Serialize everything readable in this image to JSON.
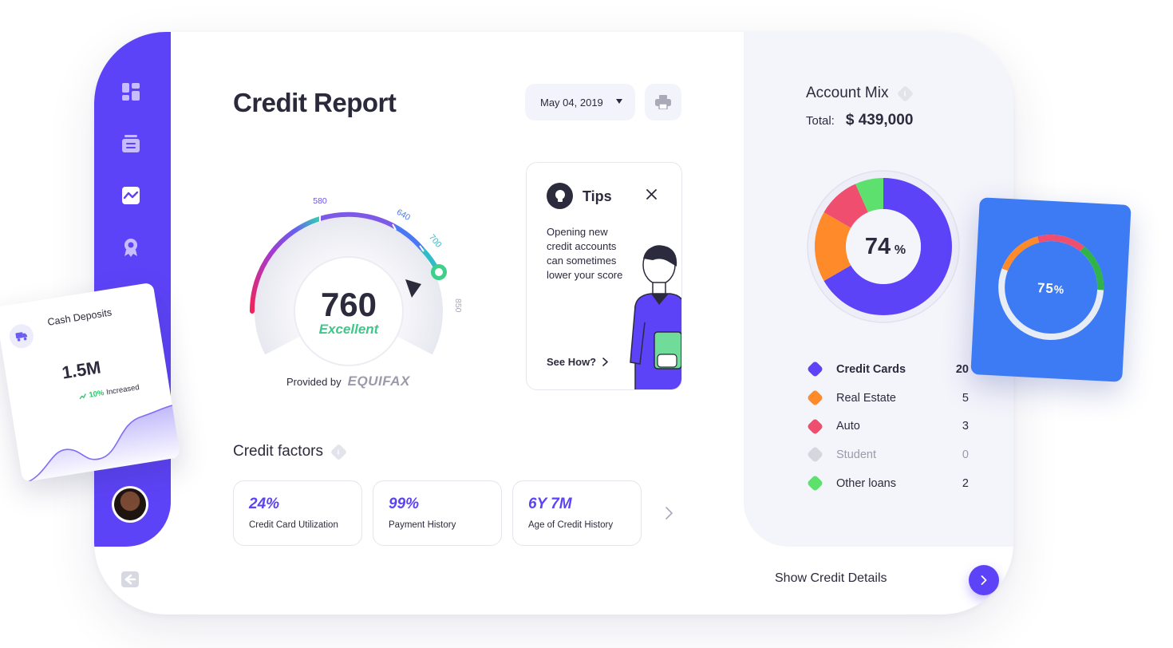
{
  "page": {
    "title": "Credit Report",
    "date": "May 04, 2019"
  },
  "sidebar": {
    "items": [
      {
        "icon": "dashboard-icon"
      },
      {
        "icon": "list-icon"
      },
      {
        "icon": "chart-icon",
        "active": true
      },
      {
        "icon": "award-icon"
      }
    ]
  },
  "score": {
    "value": "760",
    "rating": "Excellent",
    "min_label": "300",
    "max_label": "850",
    "tick_labels": [
      "580",
      "640",
      "700"
    ],
    "provider_prefix": "Provided by",
    "provider_name": "EQUIFAX"
  },
  "tips": {
    "title": "Tips",
    "text": "Opening new credit accounts can sometimes lower your score",
    "link": "See How?"
  },
  "credit_factors": {
    "title": "Credit factors",
    "info": "i",
    "items": [
      {
        "value": "24%",
        "label": "Credit Card Utilization"
      },
      {
        "value": "99%",
        "label": "Payment History"
      },
      {
        "value": "6Y 7M",
        "label": "Age of Credit History"
      }
    ]
  },
  "account_mix": {
    "title": "Account Mix",
    "info": "i",
    "total_label": "Total:",
    "total_value": "$ 439,000",
    "center_value": "74",
    "center_unit": "%",
    "legend": [
      {
        "label": "Credit Cards",
        "value": "20",
        "color": "#5d43f7"
      },
      {
        "label": "Real Estate",
        "value": "5",
        "color": "#ff8a2a"
      },
      {
        "label": "Auto",
        "value": "3",
        "color": "#f04e6e"
      },
      {
        "label": "Student",
        "value": "0",
        "color": "#d6d6df"
      },
      {
        "label": "Other loans",
        "value": "2",
        "color": "#5ee06e"
      }
    ]
  },
  "footer": {
    "show_details": "Show Credit Details"
  },
  "cash_card": {
    "title": "Cash Deposits",
    "value": "1.5M",
    "increase_pct": "10%",
    "increase_text": "Increased"
  },
  "blue_card": {
    "value": "75",
    "unit": "%"
  },
  "colors": {
    "accent": "#5d43f7",
    "success": "#3dc88a",
    "blue_card": "#3d7bf5"
  }
}
